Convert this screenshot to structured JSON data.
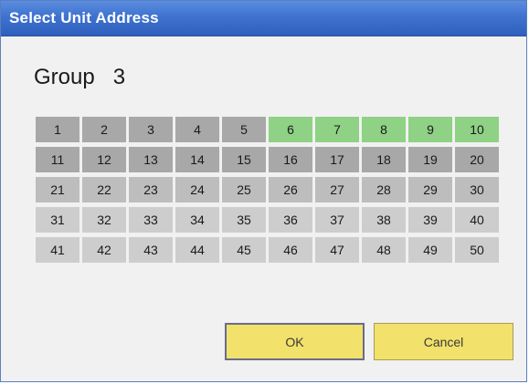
{
  "window": {
    "title": "Select Unit Address"
  },
  "group": {
    "label": "Group",
    "number": "3"
  },
  "grid": {
    "rows": [
      [
        {
          "label": "1",
          "state": "dark"
        },
        {
          "label": "2",
          "state": "dark"
        },
        {
          "label": "3",
          "state": "dark"
        },
        {
          "label": "4",
          "state": "dark"
        },
        {
          "label": "5",
          "state": "dark"
        },
        {
          "label": "6",
          "state": "green"
        },
        {
          "label": "7",
          "state": "green"
        },
        {
          "label": "8",
          "state": "green"
        },
        {
          "label": "9",
          "state": "green"
        },
        {
          "label": "10",
          "state": "green"
        }
      ],
      [
        {
          "label": "11",
          "state": "dark"
        },
        {
          "label": "12",
          "state": "dark"
        },
        {
          "label": "13",
          "state": "dark"
        },
        {
          "label": "14",
          "state": "dark"
        },
        {
          "label": "15",
          "state": "dark"
        },
        {
          "label": "16",
          "state": "dark"
        },
        {
          "label": "17",
          "state": "dark"
        },
        {
          "label": "18",
          "state": "dark"
        },
        {
          "label": "19",
          "state": "dark"
        },
        {
          "label": "20",
          "state": "dark"
        }
      ],
      [
        {
          "label": "21",
          "state": "mid"
        },
        {
          "label": "22",
          "state": "mid"
        },
        {
          "label": "23",
          "state": "mid"
        },
        {
          "label": "24",
          "state": "mid"
        },
        {
          "label": "25",
          "state": "mid"
        },
        {
          "label": "26",
          "state": "mid"
        },
        {
          "label": "27",
          "state": "mid"
        },
        {
          "label": "28",
          "state": "mid"
        },
        {
          "label": "29",
          "state": "mid"
        },
        {
          "label": "30",
          "state": "mid"
        }
      ],
      [
        {
          "label": "31",
          "state": "light"
        },
        {
          "label": "32",
          "state": "light"
        },
        {
          "label": "33",
          "state": "light"
        },
        {
          "label": "34",
          "state": "light"
        },
        {
          "label": "35",
          "state": "light"
        },
        {
          "label": "36",
          "state": "light"
        },
        {
          "label": "37",
          "state": "light"
        },
        {
          "label": "38",
          "state": "light"
        },
        {
          "label": "39",
          "state": "light"
        },
        {
          "label": "40",
          "state": "light"
        }
      ],
      [
        {
          "label": "41",
          "state": "light"
        },
        {
          "label": "42",
          "state": "light"
        },
        {
          "label": "43",
          "state": "light"
        },
        {
          "label": "44",
          "state": "light"
        },
        {
          "label": "45",
          "state": "light"
        },
        {
          "label": "46",
          "state": "light"
        },
        {
          "label": "47",
          "state": "light"
        },
        {
          "label": "48",
          "state": "light"
        },
        {
          "label": "49",
          "state": "light"
        },
        {
          "label": "50",
          "state": "light"
        }
      ]
    ]
  },
  "buttons": {
    "ok_label": "OK",
    "cancel_label": "Cancel"
  },
  "colors": {
    "titlebar": "#3f72cf",
    "selected_cell": "#8fd185",
    "cell_dark": "#a8a8a8",
    "cell_mid": "#bdbdbd",
    "cell_light": "#cdcdcd",
    "button": "#f2e16b"
  }
}
